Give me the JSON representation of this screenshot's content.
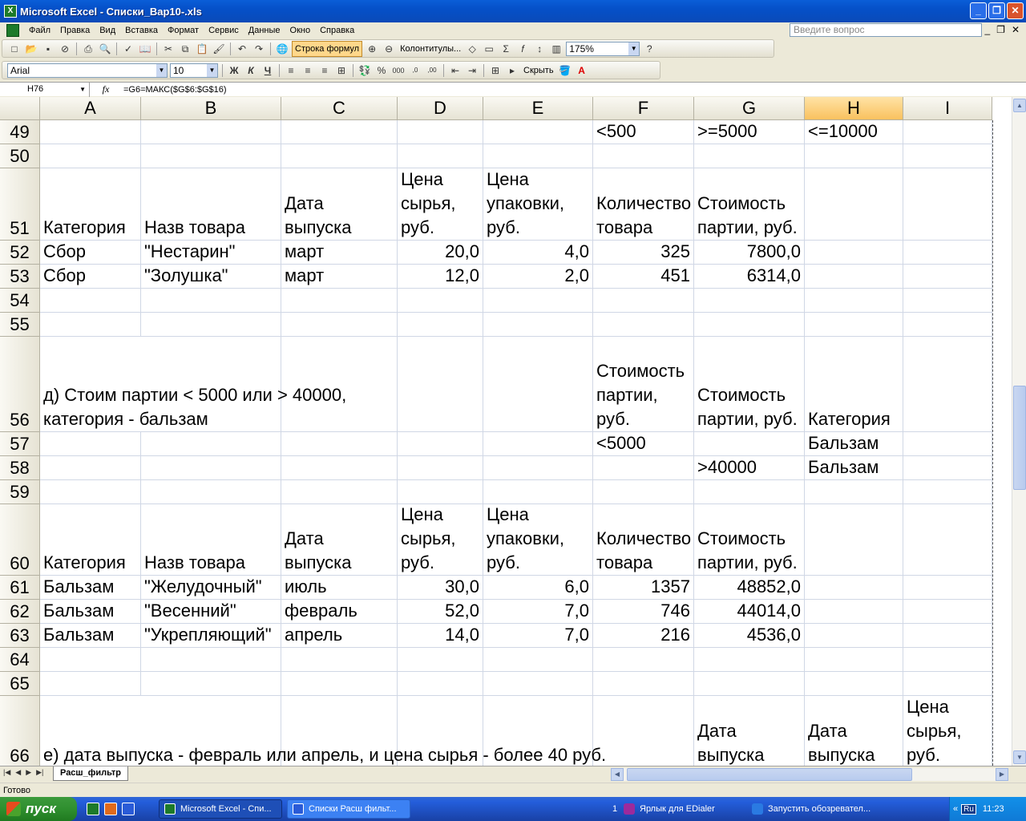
{
  "window": {
    "title": "Microsoft Excel - Списки_Вар10-.xls"
  },
  "menu": [
    "Файл",
    "Правка",
    "Вид",
    "Вставка",
    "Формат",
    "Сервис",
    "Данные",
    "Окно",
    "Справка"
  ],
  "help_placeholder": "Введите вопрос",
  "toolbar": {
    "formula_bar_btn": "Строка формул",
    "headers_btn": "Колонтитулы...",
    "zoom": "175%",
    "font": "Arial",
    "font_size": "10",
    "hide_btn": "Скрыть",
    "bold": "Ж",
    "italic": "К",
    "underline": "Ч"
  },
  "formula_bar": {
    "cell_ref": "H76",
    "fx": "fx",
    "formula": "=G6=МАКС($G$6:$G$16)"
  },
  "columns": [
    "A",
    "B",
    "C",
    "D",
    "E",
    "F",
    "G",
    "H",
    "I"
  ],
  "selected_column": "H",
  "rows": [
    {
      "num": "49",
      "cells": {
        "F": "<500",
        "G": ">=5000",
        "H": "<=10000"
      }
    },
    {
      "num": "50",
      "cells": {}
    },
    {
      "num": "51",
      "cells": {
        "A": "Категория",
        "B": "Назв товара",
        "C": "Дата выпуска",
        "D": "Цена сырья, руб.",
        "E": "Цена упаковки, руб.",
        "F": "Количество товара",
        "G": "Стоимость партии, руб."
      }
    },
    {
      "num": "52",
      "cells": {
        "A": "Сбор",
        "B": "\"Нестарин\"",
        "C": "март",
        "D": "20,0",
        "E": "4,0",
        "F": "325",
        "G": "7800,0"
      }
    },
    {
      "num": "53",
      "cells": {
        "A": "Сбор",
        "B": "\"Золушка\"",
        "C": "март",
        "D": "12,0",
        "E": "2,0",
        "F": "451",
        "G": "6314,0"
      }
    },
    {
      "num": "54",
      "cells": {}
    },
    {
      "num": "55",
      "cells": {}
    },
    {
      "num": "56",
      "cells": {
        "A": "д) Стоим партии < 5000 или > 40000, категория - бальзам",
        "F": "Стоимость партии, руб.",
        "G": "Стоимость партии, руб.",
        "H": "Категория"
      }
    },
    {
      "num": "57",
      "cells": {
        "F": "<5000",
        "H": "Бальзам"
      }
    },
    {
      "num": "58",
      "cells": {
        "G": ">40000",
        "H": "Бальзам"
      }
    },
    {
      "num": "59",
      "cells": {}
    },
    {
      "num": "60",
      "cells": {
        "A": "Категория",
        "B": "Назв товара",
        "C": "Дата выпуска",
        "D": "Цена сырья, руб.",
        "E": "Цена упаковки, руб.",
        "F": "Количество товара",
        "G": "Стоимость партии, руб."
      }
    },
    {
      "num": "61",
      "cells": {
        "A": "Бальзам",
        "B": "\"Желудочный\"",
        "C": "июль",
        "D": "30,0",
        "E": "6,0",
        "F": "1357",
        "G": "48852,0"
      }
    },
    {
      "num": "62",
      "cells": {
        "A": "Бальзам",
        "B": "\"Весенний\"",
        "C": "февраль",
        "D": "52,0",
        "E": "7,0",
        "F": "746",
        "G": "44014,0"
      }
    },
    {
      "num": "63",
      "cells": {
        "A": "Бальзам",
        "B": "\"Укрепляющий\"",
        "C": "апрель",
        "D": "14,0",
        "E": "7,0",
        "F": "216",
        "G": "4536,0"
      }
    },
    {
      "num": "64",
      "cells": {}
    },
    {
      "num": "65",
      "cells": {}
    },
    {
      "num": "66",
      "cells": {
        "A": "е) дата выпуска - февраль или апрель, и цена сырья - более 40 руб.",
        "G": "Дата выпуска",
        "H": "Дата выпуска",
        "I": "Цена сырья, руб."
      }
    }
  ],
  "sheet_tab": "Расш_фильтр",
  "status": "Готово",
  "taskbar": {
    "start": "пуск",
    "buttons": [
      "Microsoft Excel - Спи...",
      "Списки Расш фильт..."
    ],
    "tray_count": "1",
    "tray_items": [
      "Ярлык для EDialer",
      "Запустить обозревател..."
    ],
    "lang": "Ru",
    "clock": "11:23"
  }
}
